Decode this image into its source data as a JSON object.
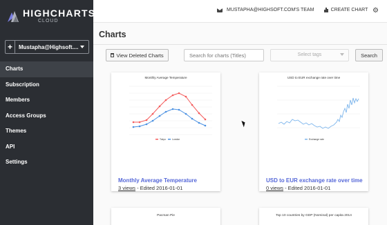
{
  "brand": {
    "name": "HIGHCHARTS",
    "sub": "CLOUD"
  },
  "account": {
    "plus": "+",
    "name": "Mustapha@Highsoft...."
  },
  "nav": [
    {
      "label": "Charts",
      "active": true
    },
    {
      "label": "Subscription"
    },
    {
      "label": "Members"
    },
    {
      "label": "Access Groups"
    },
    {
      "label": "Themes"
    },
    {
      "label": "API"
    },
    {
      "label": "Settings"
    }
  ],
  "topbar": {
    "team": "MUSTAPHA@HIGHSOFT.COM'S TEAM",
    "create": "CREATE CHART"
  },
  "page": {
    "title": "Charts"
  },
  "toolbar": {
    "deleted_label": "View Deleted Charts",
    "search_placeholder": "Search for charts (Titles)",
    "tags_placeholder": "Select tags",
    "search_button": "Search"
  },
  "cards": [
    {
      "title": "Monthly Average Temperature",
      "views": "3 views",
      "edited": " - Edited 2016-01-01",
      "thumb_title": "Monthly Average Temperature",
      "legend": [
        "Tokyo",
        "London"
      ]
    },
    {
      "title": "USD to EUR exchange rate over time",
      "views": "0 views",
      "edited": " - Edited 2016-01-01",
      "thumb_title": "USD to EUR exchange rate over time",
      "legend": [
        "Exchange rate"
      ]
    },
    {
      "thumb_title": "Pacman Pie"
    },
    {
      "thumb_title": "Top 10 countries by GDP (Nominal) per capita 2014"
    }
  ],
  "colors": {
    "sidebar": "#2b2e33",
    "accent": "#5567d8",
    "series_red": "#f45b5b",
    "series_blue": "#4a90e2",
    "line_light": "#7cb5ec"
  }
}
